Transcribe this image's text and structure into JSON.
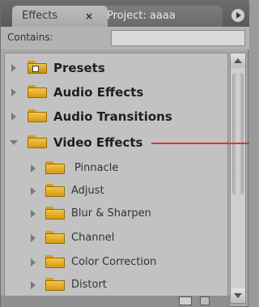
{
  "tabs": {
    "effects_label": "Effects",
    "close_glyph": "×",
    "project_label": "Project: aaaa"
  },
  "contains": {
    "label": "Contains:",
    "value": ""
  },
  "tree": {
    "items": [
      {
        "label": "Presets",
        "level": 0,
        "expanded": false,
        "icon": "preset-folder-icon"
      },
      {
        "label": "Audio Effects",
        "level": 0,
        "expanded": false,
        "icon": "folder-icon"
      },
      {
        "label": "Audio Transitions",
        "level": 0,
        "expanded": false,
        "icon": "folder-icon"
      },
      {
        "label": "Video Effects",
        "level": 0,
        "expanded": true,
        "icon": "folder-icon"
      },
      {
        "label": "Pinnacle",
        "level": 1,
        "expanded": false,
        "icon": "folder-icon"
      },
      {
        "label": "Adjust",
        "level": 1,
        "expanded": false,
        "icon": "folder-icon"
      },
      {
        "label": "Blur & Sharpen",
        "level": 1,
        "expanded": false,
        "icon": "folder-icon"
      },
      {
        "label": "Channel",
        "level": 1,
        "expanded": false,
        "icon": "folder-icon"
      },
      {
        "label": "Color Correction",
        "level": 1,
        "expanded": false,
        "icon": "folder-icon"
      },
      {
        "label": "Distort",
        "level": 1,
        "expanded": false,
        "icon": "folder-icon"
      }
    ]
  },
  "colors": {
    "panel_bg": "#a9a9a9",
    "callout": "#d23a2a",
    "folder": "#f3c64a"
  }
}
